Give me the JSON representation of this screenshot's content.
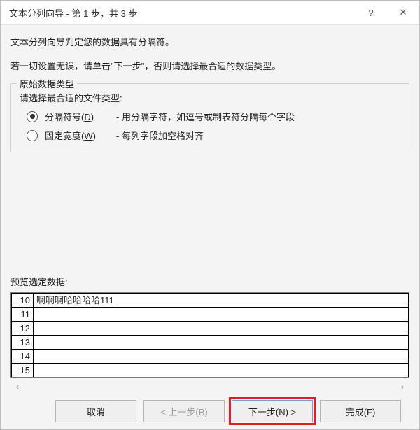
{
  "window": {
    "title": "文本分列向导 - 第 1 步，共 3 步",
    "help_icon": "?",
    "close_icon": "✕"
  },
  "intro": {
    "line1": "文本分列向导判定您的数据具有分隔符。",
    "line2": "若一切设置无误，请单击\"下一步\"，否则请选择最合适的数据类型。"
  },
  "group": {
    "legend": "原始数据类型",
    "prompt": "请选择最合适的文件类型:",
    "options": [
      {
        "label_prefix": "分隔符号(",
        "hotkey": "D",
        "label_suffix": ")",
        "desc": "- 用分隔字符，如逗号或制表符分隔每个字段",
        "selected": true
      },
      {
        "label_prefix": "固定宽度(",
        "hotkey": "W",
        "label_suffix": ")",
        "desc": "- 每列字段加空格对齐",
        "selected": false
      }
    ]
  },
  "preview": {
    "label": "预览选定数据:",
    "rows": [
      {
        "n": "10",
        "text": "啊啊啊哈哈哈哈111"
      },
      {
        "n": "11",
        "text": ""
      },
      {
        "n": "12",
        "text": ""
      },
      {
        "n": "13",
        "text": ""
      },
      {
        "n": "14",
        "text": ""
      },
      {
        "n": "15",
        "text": ""
      }
    ],
    "scroll_left": "‹",
    "scroll_right": "›"
  },
  "buttons": {
    "cancel": "取消",
    "back": "< 上一步(B)",
    "next": "下一步(N) >",
    "finish": "完成(F)"
  }
}
